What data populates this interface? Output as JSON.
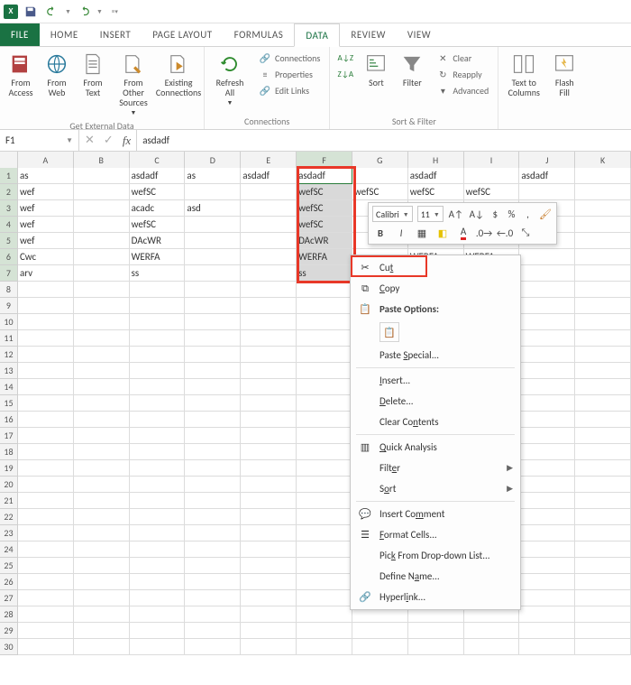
{
  "qat": {
    "app": "X"
  },
  "tabs": {
    "file": "FILE",
    "home": "HOME",
    "insert": "INSERT",
    "pagelayout": "PAGE LAYOUT",
    "formulas": "FORMULAS",
    "data": "DATA",
    "review": "REVIEW",
    "view": "VIEW"
  },
  "ribbon": {
    "from_access": "From Access",
    "from_web": "From Web",
    "from_text": "From Text",
    "from_other": "From Other Sources",
    "existing": "Existing Connections",
    "get_ext_title": "Get External Data",
    "refresh": "Refresh All",
    "connections": "Connections",
    "properties": "Properties",
    "edit_links": "Edit Links",
    "conn_title": "Connections",
    "sort_az": "A→Z",
    "sort_za": "Z→A",
    "sort": "Sort",
    "filter": "Filter",
    "clear": "Clear",
    "reapply": "Reapply",
    "advanced": "Advanced",
    "sort_filter_title": "Sort & Filter",
    "text_to_cols": "Text to Columns",
    "flash_fill": "Flash Fill"
  },
  "fbar": {
    "name": "F1",
    "value": "asdadf"
  },
  "columns": [
    "A",
    "B",
    "C",
    "D",
    "E",
    "F",
    "G",
    "H",
    "I",
    "J",
    "K"
  ],
  "cells": {
    "r1": {
      "A": "as",
      "C": "asdadf",
      "D": "as",
      "E": "asdadf",
      "F": "asdadf",
      "H": "asdadf",
      "J": "asdadf"
    },
    "r2": {
      "A": "wef",
      "C": "wefSC",
      "F": "wefSC",
      "G": "wefSC",
      "H": "wefSC",
      "I": "wefSC"
    },
    "r3": {
      "A": "wef",
      "C": "acadc",
      "D": "asd",
      "F": "wefSC"
    },
    "r4": {
      "A": "wef",
      "C": "wefSC",
      "F": "wefSC"
    },
    "r5": {
      "A": "wef",
      "C": "DAcWR",
      "F": "DAcWR"
    },
    "r6": {
      "A": "Cwc",
      "C": "WERFA",
      "F": "WERFA",
      "H": "WERFA",
      "I": "WERFA"
    },
    "r7": {
      "A": "arv",
      "C": "ss",
      "F": "ss"
    }
  },
  "minitb": {
    "font": "Calibri",
    "size": "11"
  },
  "ctx": {
    "cut": "Cut",
    "copy": "Copy",
    "pasteopt": "Paste Options:",
    "paste_special": "Paste Special...",
    "insert": "Insert...",
    "delete": "Delete...",
    "clear": "Clear Contents",
    "qa": "Quick Analysis",
    "filter": "Filter",
    "sort": "Sort",
    "comment": "Insert Comment",
    "format": "Format Cells...",
    "pick": "Pick From Drop-down List...",
    "define": "Define Name...",
    "hyperlink": "Hyperlink..."
  }
}
